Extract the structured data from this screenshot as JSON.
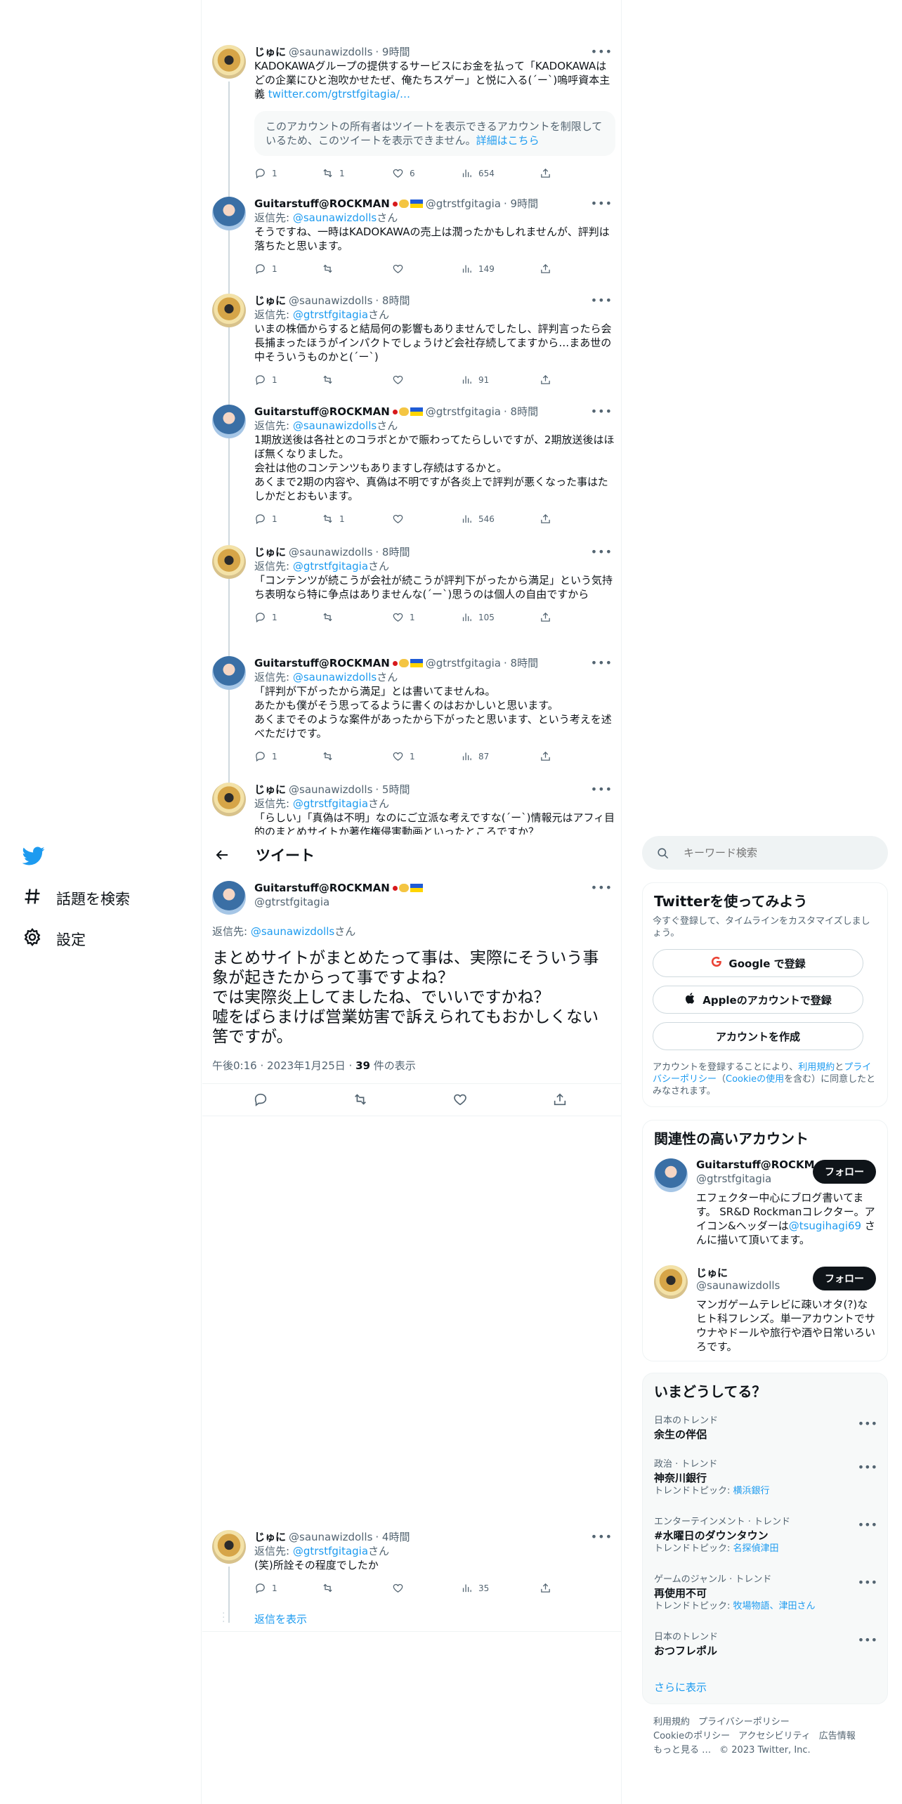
{
  "nav": {
    "logo": "twitter-bird",
    "items": [
      {
        "label": "話題を検索",
        "icon": "hash-icon"
      },
      {
        "label": "設定",
        "icon": "gear-icon"
      }
    ]
  },
  "header": {
    "title": "ツイート"
  },
  "thread": [
    {
      "name": "じゅに",
      "handle": "@saunawizdolls",
      "time": "· 9時間",
      "avatar": "gold",
      "reply_prefix": "",
      "reply_to": "",
      "reply_suffix": "",
      "text": "KADOKAWAグループの提供するサービスにお金を払って「KADOKAWAはどの企業にひと泡吹かせたぜ、俺たちスゲー」と悦に入る(´ー`)嗚呼資本主義 ",
      "link": "twitter.com/gtrstfgitagia/…",
      "notice": "このアカウントの所有者はツイートを表示できるアカウントを制限しているため、このツイートを表示できません。",
      "notice_link": "詳細はこちら",
      "replies": "1",
      "retweets": "1",
      "likes": "6",
      "views": "654"
    },
    {
      "name": "Guitarstuff@ROCKMAN",
      "handle": "@gtrstfgitagia",
      "time": "· 9時間",
      "avatar": "blue",
      "reply_prefix": "返信先: ",
      "reply_to": "@saunawizdolls",
      "reply_suffix": "さん",
      "text": "そうですね、一時はKADOKAWAの売上は潤ったかもしれませんが、評判は落ちたと思います。",
      "replies": "1",
      "retweets": "",
      "likes": "",
      "views": "149"
    },
    {
      "name": "じゅに",
      "handle": "@saunawizdolls",
      "time": "· 8時間",
      "avatar": "gold",
      "reply_prefix": "返信先: ",
      "reply_to": "@gtrstfgitagia",
      "reply_suffix": "さん",
      "text": "いまの株価からすると結局何の影響もありませんでしたし、評判言ったら会長捕まったほうがインパクトでしょうけど会社存続してますから…まあ世の中そういうものかと(´ー`)",
      "replies": "1",
      "retweets": "",
      "likes": "",
      "views": "91"
    },
    {
      "name": "Guitarstuff@ROCKMAN",
      "handle": "@gtrstfgitagia",
      "time": "· 8時間",
      "avatar": "blue",
      "reply_prefix": "返信先: ",
      "reply_to": "@saunawizdolls",
      "reply_suffix": "さん",
      "text": "1期放送後は各社とのコラボとかで賑わってたらしいですが、2期放送後はほぼ無くなりました。\n会社は他のコンテンツもありますし存続はするかと。\nあくまで2期の内容や、真偽は不明ですが各炎上で評判が悪くなった事はたしかだとおもいます。",
      "replies": "1",
      "retweets": "1",
      "likes": "",
      "views": "546"
    },
    {
      "name": "じゅに",
      "handle": "@saunawizdolls",
      "time": "· 8時間",
      "avatar": "gold",
      "reply_prefix": "返信先: ",
      "reply_to": "@gtrstfgitagia",
      "reply_suffix": "さん",
      "text": "「コンテンツが続こうが会社が続こうが評判下がったから満足」という気持ち表明なら特に争点はありませんな(´ー`)思うのは個人の自由ですから",
      "replies": "1",
      "retweets": "",
      "likes": "1",
      "views": "105"
    },
    {
      "name": "Guitarstuff@ROCKMAN",
      "handle": "@gtrstfgitagia",
      "time": "· 8時間",
      "avatar": "blue",
      "reply_prefix": "返信先: ",
      "reply_to": "@saunawizdolls",
      "reply_suffix": "さん",
      "text": "「評判が下がったから満足」とは書いてませんね。\nあたかも僕がそう思ってるように書くのはおかしいと思います。\nあくまでそのような案件があったから下がったと思います、という考えを述べただけです。",
      "replies": "1",
      "retweets": "",
      "likes": "1",
      "views": "87"
    },
    {
      "name": "じゅに",
      "handle": "@saunawizdolls",
      "time": "· 5時間",
      "avatar": "gold",
      "reply_prefix": "返信先: ",
      "reply_to": "@gtrstfgitagia",
      "reply_suffix": "さん",
      "text": "「らしい」「真偽は不明」なのにご立派な考えですな(´ー`)情報元はアフィ目的のまとめサイトか著作権侵害動画といったところですか？",
      "replies": "",
      "retweets": "",
      "likes": "",
      "views": ""
    }
  ],
  "main_tweet": {
    "name": "Guitarstuff@ROCKMAN",
    "handle": "@gtrstfgitagia",
    "reply_prefix": "返信先: ",
    "reply_to": "@saunawizdolls",
    "reply_suffix": "さん",
    "text": "まとめサイトがまとめたって事は、実際にそういう事象が起きたからって事ですよね？\nでは実際炎上してましたね、でいいですかね？\n嘘をばらまけば営業妨害で訴えられてもおかしくない筈ですが。",
    "date": "午後0:16 · 2023年1月25日 · ",
    "views_count": "39",
    "views_label": " 件の表示"
  },
  "reply_tweet": {
    "name": "じゅに",
    "handle": "@saunawizdolls",
    "time": "· 4時間",
    "reply_prefix": "返信先: ",
    "reply_to": "@gtrstfgitagia",
    "reply_suffix": "さん",
    "text": "(笑)所詮その程度でしたか",
    "replies": "1",
    "retweets": "",
    "likes": "",
    "views": "35",
    "show_replies": "返信を表示"
  },
  "sidebar": {
    "search_placeholder": "キーワード検索",
    "signup": {
      "title": "Twitterを使ってみよう",
      "subtitle": "今すぐ登録して、タイムラインをカスタマイズしましょう。",
      "google": "Google で登録",
      "apple": "Appleのアカウントで登録",
      "create": "アカウントを作成",
      "terms_prefix": "アカウントを登録することにより、",
      "terms_link1": "利用規約",
      "terms_mid1": "と",
      "terms_link2": "プライバシーポリシー",
      "terms_mid2": "（",
      "terms_link3": "Cookieの使用",
      "terms_suffix": "を含む）に同意したとみなされます。"
    },
    "related": {
      "title": "関連性の高いアカウント",
      "accounts": [
        {
          "name": "Guitarstuff@ROCKM…",
          "handle": "@gtrstfgitagia",
          "follow": "フォロー",
          "bio_pre": "エフェクター中心にブログ書いてます。 SR&D Rockmanコレクター。アイコン&ヘッダーは",
          "bio_link": "@tsugihagi69",
          "bio_post": " さんに描いて頂いてます。"
        },
        {
          "name": "じゅに",
          "handle": "@saunawizdolls",
          "follow": "フォロー",
          "bio_pre": "マンガゲームテレビに疎いオタ(?)なヒト科フレンズ。単一アカウントでサウナやドールや旅行や酒や日常いろいろです。",
          "bio_link": "",
          "bio_post": ""
        }
      ]
    },
    "trends": {
      "title": "いまどうしてる？",
      "items": [
        {
          "category": "日本のトレンド",
          "name": "余生の伴侶",
          "topic_label": "",
          "topic": ""
        },
        {
          "category": "政治 · トレンド",
          "name": "神奈川銀行",
          "topic_label": "トレンドトピック: ",
          "topic": "横浜銀行"
        },
        {
          "category": "エンターテインメント · トレンド",
          "name": "#水曜日のダウンタウン",
          "topic_label": "トレンドトピック: ",
          "topic": "名探偵津田"
        },
        {
          "category": "ゲームのジャンル · トレンド",
          "name": "再使用不可",
          "topic_label": "トレンドトピック: ",
          "topic": "牧場物語、津田さん"
        },
        {
          "category": "日本のトレンド",
          "name": "おつフレポル",
          "topic_label": "",
          "topic": ""
        }
      ],
      "show_more": "さらに表示"
    },
    "footer": {
      "line1": [
        "利用規約",
        "プライバシーポリシー"
      ],
      "line2": [
        "Cookieのポリシー",
        "アクセシビリティ",
        "広告情報"
      ],
      "more": "もっと見る …",
      "copyright": "© 2023 Twitter, Inc."
    }
  },
  "colors": {
    "accent": "#1d9bf0",
    "text": "#0f1419",
    "muted": "#536471",
    "border": "#eff3f4"
  }
}
